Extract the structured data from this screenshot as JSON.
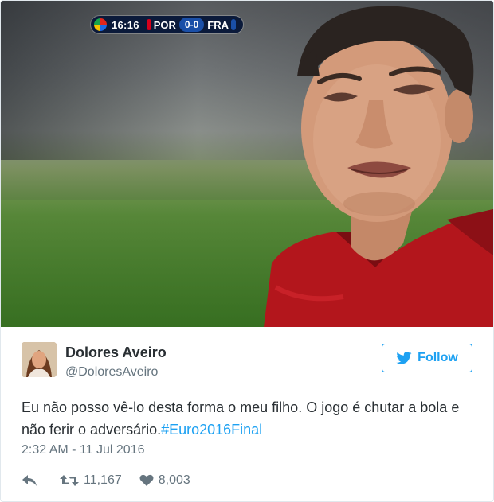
{
  "scorebug": {
    "clock": "16:16",
    "home_team": "POR",
    "score": "0-0",
    "away_team": "FRA",
    "home_color": "#d6001c",
    "away_color": "#1a4fa8"
  },
  "tweet": {
    "author_name": "Dolores Aveiro",
    "author_handle": "@DoloresAveiro",
    "follow_label": "Follow",
    "text": "Eu não posso vê-lo desta forma o meu filho. O jogo é chutar a bola e não ferir o adversário.",
    "hashtag": "#Euro2016Final",
    "timestamp": "2:32 AM - 11 Jul 2016",
    "retweets": "11,167",
    "likes": "8,003"
  },
  "colors": {
    "accent": "#1da1f2",
    "text": "#292f33",
    "muted": "#66757f"
  },
  "icons": {
    "follow": "twitter-bird-icon",
    "reply": "reply-icon",
    "retweet": "retweet-icon",
    "like": "heart-icon"
  }
}
